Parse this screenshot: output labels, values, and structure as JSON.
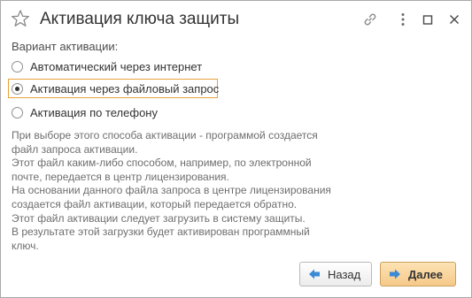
{
  "window": {
    "title": "Активация ключа защиты"
  },
  "form": {
    "group_label": "Вариант активации:",
    "options": [
      {
        "label": "Автоматический через интернет",
        "checked": false
      },
      {
        "label": "Активация через файловый запрос",
        "checked": true
      },
      {
        "label": "Активация по телефону",
        "checked": false
      }
    ]
  },
  "description": {
    "lines": [
      "При выборе этого способа активации - программой создается",
      "файл запроса активации.",
      "Этот файл каким-либо способом, например, по электронной",
      "почте, передается в центр лицензирования.",
      "На основании данного файла запроса в центре лицензирования",
      "создается файл активации, который передается обратно.",
      "Этот файл активации следует загрузить в систему защиты.",
      "В результате этой загрузки будет активирован программный",
      "ключ."
    ]
  },
  "buttons": {
    "back_label": "Назад",
    "next_label": "Далее"
  },
  "colors": {
    "focus_outline": "#e9a23a",
    "arrow_back": "#3a8ad6",
    "arrow_next": "#3a8ad6",
    "primary_button": "#f6c989"
  },
  "icons": {
    "favorite": "star-icon",
    "link": "link-icon",
    "more": "more-icon",
    "maximize": "maximize-icon",
    "close": "close-icon",
    "back": "arrow-left-icon",
    "next": "arrow-right-icon"
  }
}
